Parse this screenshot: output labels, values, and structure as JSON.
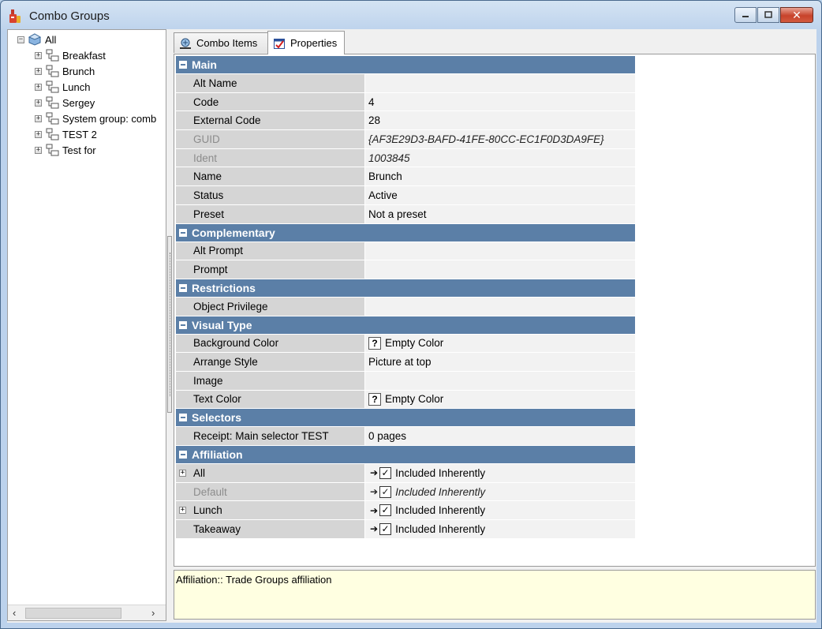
{
  "window": {
    "title": "Combo Groups"
  },
  "tree": {
    "root": "All",
    "items": [
      {
        "label": "Breakfast"
      },
      {
        "label": "Brunch"
      },
      {
        "label": "Lunch"
      },
      {
        "label": "Sergey"
      },
      {
        "label": "System group: comb"
      },
      {
        "label": "TEST 2"
      },
      {
        "label": "Test for"
      }
    ]
  },
  "tabs": [
    {
      "label": "Combo Items",
      "icon": "combo-items-icon"
    },
    {
      "label": "Properties",
      "icon": "properties-icon",
      "active": true
    }
  ],
  "sections": {
    "main": {
      "title": "Main",
      "rows": [
        {
          "name": "Alt Name",
          "value": ""
        },
        {
          "name": "Code",
          "value": "4"
        },
        {
          "name": "External Code",
          "value": "28"
        },
        {
          "name": "GUID",
          "value": "{AF3E29D3-BAFD-41FE-80CC-EC1F0D3DA9FE}"
        },
        {
          "name": "Ident",
          "value": "1003845"
        },
        {
          "name": "Name",
          "value": "Brunch"
        },
        {
          "name": "Status",
          "value": "Active"
        },
        {
          "name": "Preset",
          "value": "Not a preset"
        }
      ]
    },
    "complementary": {
      "title": "Complementary",
      "rows": [
        {
          "name": "Alt Prompt",
          "value": ""
        },
        {
          "name": "Prompt",
          "value": ""
        }
      ]
    },
    "restrictions": {
      "title": "Restrictions",
      "rows": [
        {
          "name": "Object Privilege",
          "value": ""
        }
      ]
    },
    "visual": {
      "title": "Visual Type",
      "rows": [
        {
          "name": "Background Color",
          "value": "Empty Color",
          "q": "?"
        },
        {
          "name": "Arrange Style",
          "value": "Picture at top"
        },
        {
          "name": "Image",
          "value": ""
        },
        {
          "name": "Text Color",
          "value": "Empty Color",
          "q": "?"
        }
      ]
    },
    "selectors": {
      "title": "Selectors",
      "rows": [
        {
          "name": "Receipt: Main selector TEST",
          "value": "0 pages"
        }
      ]
    },
    "affiliation": {
      "title": "Affiliation",
      "rows": [
        {
          "name": "All",
          "value": "Included Inherently"
        },
        {
          "name": "Default",
          "value": "Included Inherently"
        },
        {
          "name": "Lunch",
          "value": "Included Inherently"
        },
        {
          "name": "Takeaway",
          "value": "Included Inherently"
        }
      ]
    }
  },
  "description": "Affiliation:: Trade Groups affiliation",
  "colors": {
    "category": "#5b7fa7",
    "description_bg": "#ffffe1",
    "name_cell": "#d5d5d5"
  }
}
